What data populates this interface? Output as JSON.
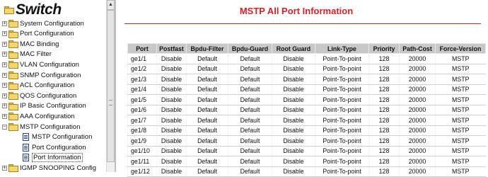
{
  "tree": {
    "root_label": "Switch",
    "items": [
      {
        "label": "System Configuration",
        "expanded": false
      },
      {
        "label": "Port Configuration",
        "expanded": false
      },
      {
        "label": "MAC Binding",
        "expanded": false
      },
      {
        "label": "MAC Filter",
        "expanded": false
      },
      {
        "label": "VLAN Configuration",
        "expanded": false
      },
      {
        "label": "SNMP Configuration",
        "expanded": false
      },
      {
        "label": "ACL Configuration",
        "expanded": false
      },
      {
        "label": "QOS Configuration",
        "expanded": false
      },
      {
        "label": "IP Basic Configuration",
        "expanded": false
      },
      {
        "label": "AAA Configuration",
        "expanded": false
      },
      {
        "label": "MSTP Configuration",
        "expanded": true
      },
      {
        "label": "IGMP SNOOPING Config",
        "expanded": false
      }
    ],
    "sub_items": [
      {
        "label": "MSTP Configuration"
      },
      {
        "label": "Port Configuration"
      },
      {
        "label": "Port Information",
        "selected": true
      }
    ],
    "expand_symbol": "+",
    "collapse_symbol": "−",
    "scroll_up_arrow": "▲"
  },
  "main": {
    "title": "MSTP All Port Information",
    "columns": [
      "Port",
      "Postfast",
      "Bpdu-Filter",
      "Bpdu-Guard",
      "Root Guard",
      "Link-Type",
      "Priority",
      "Path-Cost",
      "Force-Version"
    ],
    "rows": [
      [
        "ge1/1",
        "Disable",
        "Default",
        "Default",
        "Disable",
        "Point-To-point",
        "128",
        "20000",
        "MSTP"
      ],
      [
        "ge1/2",
        "Disable",
        "Default",
        "Default",
        "Disable",
        "Point-To-point",
        "128",
        "20000",
        "MSTP"
      ],
      [
        "ge1/3",
        "Disable",
        "Default",
        "Default",
        "Disable",
        "Point-To-point",
        "128",
        "20000",
        "MSTP"
      ],
      [
        "ge1/4",
        "Disable",
        "Default",
        "Default",
        "Disable",
        "Point-To-point",
        "128",
        "20000",
        "MSTP"
      ],
      [
        "ge1/5",
        "Disable",
        "Default",
        "Default",
        "Disable",
        "Point-To-point",
        "128",
        "20000",
        "MSTP"
      ],
      [
        "ge1/6",
        "Disable",
        "Default",
        "Default",
        "Disable",
        "Point-To-point",
        "128",
        "20000",
        "MSTP"
      ],
      [
        "ge1/7",
        "Disable",
        "Default",
        "Default",
        "Disable",
        "Point-To-point",
        "128",
        "20000",
        "MSTP"
      ],
      [
        "ge1/8",
        "Disable",
        "Default",
        "Default",
        "Disable",
        "Point-To-point",
        "128",
        "20000",
        "MSTP"
      ],
      [
        "ge1/9",
        "Disable",
        "Default",
        "Default",
        "Disable",
        "Point-To-point",
        "128",
        "20000",
        "MSTP"
      ],
      [
        "ge1/10",
        "Disable",
        "Default",
        "Default",
        "Disable",
        "Point-To-point",
        "128",
        "20000",
        "MSTP"
      ],
      [
        "ge1/11",
        "Disable",
        "Default",
        "Default",
        "Disable",
        "Point-To-point",
        "128",
        "20000",
        "MSTP"
      ],
      [
        "ge1/12",
        "Disable",
        "Default",
        "Default",
        "Disable",
        "Point-To-point",
        "128",
        "20000",
        "MSTP"
      ]
    ]
  },
  "colors": {
    "title_red": "#d6202a",
    "header_gray": "#c8c8c8",
    "folder_yellow": "#f4d670"
  }
}
